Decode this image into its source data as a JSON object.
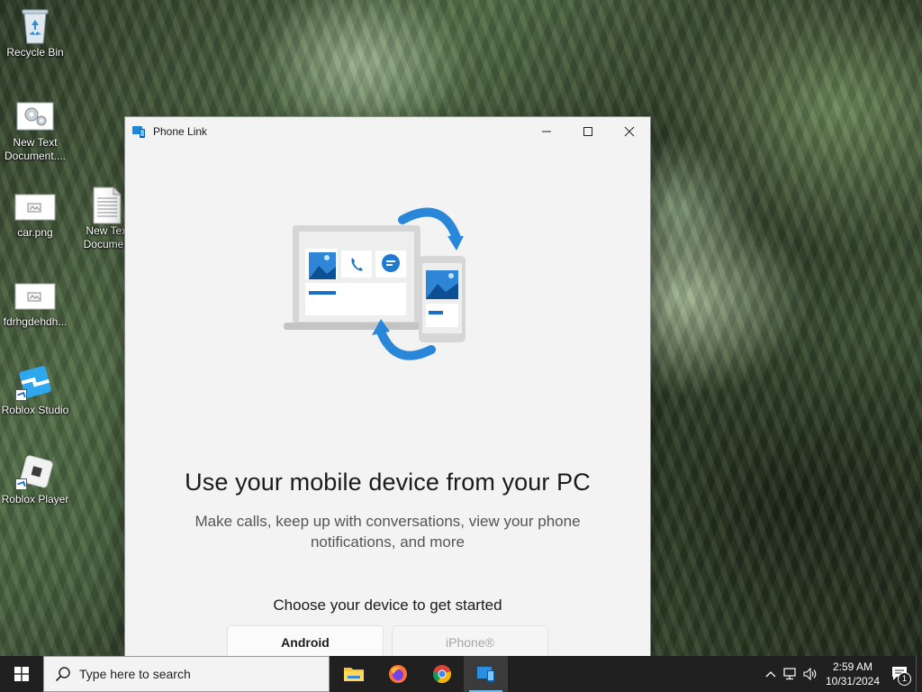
{
  "desktop": {
    "icons": [
      {
        "label": "Recycle Bin"
      },
      {
        "label": "New Text Document...."
      },
      {
        "label": "car.png"
      },
      {
        "label": "New Text Document"
      },
      {
        "label": "fdrhgdehdh..."
      },
      {
        "label": "Roblox Studio"
      },
      {
        "label": "Roblox Player"
      }
    ]
  },
  "window": {
    "title": "Phone Link",
    "heading": "Use your mobile device from your PC",
    "subtitle": "Make calls, keep up with conversations, view your phone notifications, and more",
    "choose_label": "Choose your device to get started",
    "android_label": "Android",
    "iphone_label": "iPhone®"
  },
  "taskbar": {
    "search_placeholder": "Type here to search",
    "apps": [
      "file-explorer",
      "firefox",
      "chrome",
      "phone-link"
    ],
    "time": "2:59 AM",
    "date": "10/31/2024",
    "notification_count": "1"
  },
  "colors": {
    "accent": "#0f6cbd",
    "taskbar": "#202020",
    "window_bg": "#f3f3f3"
  }
}
